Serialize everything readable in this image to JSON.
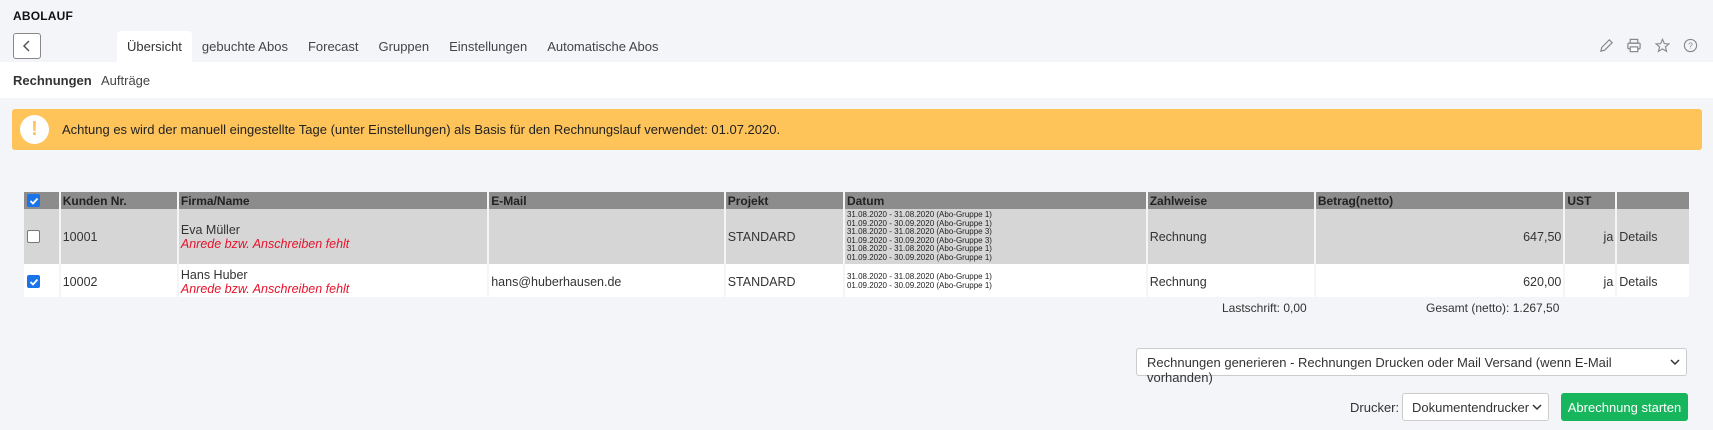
{
  "app": {
    "title": "ABOLAUF"
  },
  "tabs": [
    {
      "label": "Übersicht"
    },
    {
      "label": "gebuchte Abos"
    },
    {
      "label": "Forecast"
    },
    {
      "label": "Gruppen"
    },
    {
      "label": "Einstellungen"
    },
    {
      "label": "Automatische Abos"
    }
  ],
  "subtabs": [
    {
      "label": "Rechnungen"
    },
    {
      "label": "Aufträge"
    }
  ],
  "alert": {
    "icon": "exclamation-icon",
    "text": "Achtung es wird der manuell eingestellte Tage (unter Einstellungen) als Basis für den Rechnungslauf verwendet: 01.07.2020."
  },
  "table": {
    "headers": [
      "Kunden Nr.",
      "Firma/Name",
      "E-Mail",
      "Projekt",
      "Datum",
      "Zahlweise",
      "Betrag(netto)",
      "UST",
      ""
    ],
    "rows": [
      {
        "checked": false,
        "kunden_nr": "10001",
        "name": "Eva Müller",
        "warning": "Anrede bzw. Anschreiben fehlt",
        "email": "",
        "projekt": "STANDARD",
        "dates": [
          "31.08.2020 - 31.08.2020 (Abo-Gruppe 1)",
          "01.09.2020 - 30.09.2020 (Abo-Gruppe 1)",
          "31.08.2020 - 31.08.2020 (Abo-Gruppe 3)",
          "01.09.2020 - 30.09.2020 (Abo-Gruppe 3)",
          "31.08.2020 - 31.08.2020 (Abo-Gruppe 1)",
          "01.09.2020 - 30.09.2020 (Abo-Gruppe 1)"
        ],
        "zahlweise": "Rechnung",
        "betrag": "647,50",
        "ust": "ja",
        "action": "Details"
      },
      {
        "checked": true,
        "kunden_nr": "10002",
        "name": "Hans Huber",
        "warning": "Anrede bzw. Anschreiben fehlt",
        "email": "hans@huberhausen.de",
        "projekt": "STANDARD",
        "dates": [
          "31.08.2020 - 31.08.2020 (Abo-Gruppe 1)",
          "01.09.2020 - 30.09.2020 (Abo-Gruppe 1)"
        ],
        "zahlweise": "Rechnung",
        "betrag": "620,00",
        "ust": "ja",
        "action": "Details"
      }
    ]
  },
  "summary": {
    "lastschrift": "Lastschrift: 0,00",
    "gesamt": "Gesamt (netto): 1.267,50"
  },
  "generate_select": {
    "value": "Rechnungen generieren - Rechnungen Drucken oder Mail Versand (wenn E-Mail vorhanden)"
  },
  "printer": {
    "label": "Drucker:",
    "value": "Dokumentendrucker"
  },
  "start_button": {
    "label": "Abrechnung starten"
  },
  "colors": {
    "alert": "#fec45a",
    "accent": "#17b65c",
    "checkbox": "#1a73e8",
    "warning": "#e8122a",
    "header": "#8c8c8c"
  }
}
